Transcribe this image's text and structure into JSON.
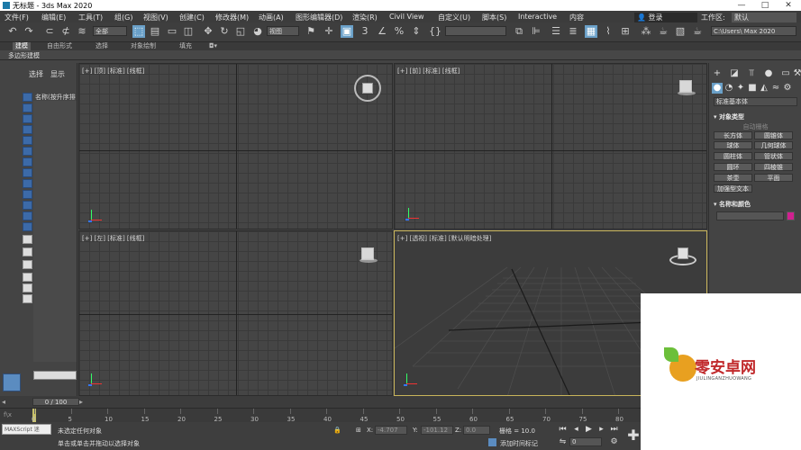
{
  "window": {
    "title": "无标题 - 3ds Max 2020",
    "min": "—",
    "max": "□",
    "close": "✕"
  },
  "menu": [
    "文件(F)",
    "编辑(E)",
    "工具(T)",
    "组(G)",
    "视图(V)",
    "创建(C)",
    "修改器(M)",
    "动画(A)",
    "图形编辑器(D)",
    "渲染(R)",
    "Civil View",
    "自定义(U)",
    "脚本(S)",
    "Interactive",
    "内容"
  ],
  "user": {
    "login": "登录",
    "workspace_label": "工作区:",
    "workspace_value": "默认"
  },
  "toolbar": {
    "selection_filter": "全部",
    "view_dropdown": "视图",
    "path": "C:\\Users\\ Max 2020"
  },
  "ribbon": {
    "tabs": [
      "建模",
      "自由形式",
      "选择",
      "对象绘制",
      "填充"
    ],
    "active_tab": "建模",
    "subbar": "多边形建模"
  },
  "scene_explorer": {
    "tabs": [
      "选择",
      "显示"
    ],
    "column_header": "名称(按升序排"
  },
  "viewports": {
    "top": "[+] [顶] [标准] [线框]",
    "front": "[+] [前] [标准] [线框]",
    "left": "[+] [左] [标准] [线框]",
    "persp": "[+] [透视] [标准] [默认明暗处理]"
  },
  "command_panel": {
    "category": "标准基本体",
    "object_type_header": "对象类型",
    "auto_grid": "自动栅格",
    "buttons": [
      "长方体",
      "圆锥体",
      "球体",
      "几何球体",
      "圆柱体",
      "管状体",
      "圆环",
      "四棱锥",
      "茶壶",
      "平面",
      "加强型文本"
    ],
    "name_color_header": "名称和颜色",
    "color": "#d02090"
  },
  "timeline": {
    "slider": "0 / 100",
    "ticks": [
      "0",
      "5",
      "10",
      "15",
      "20",
      "25",
      "30",
      "35",
      "40",
      "45",
      "50",
      "55",
      "60",
      "65",
      "70",
      "75",
      "80"
    ]
  },
  "status": {
    "script_listener": "MAXScript 迷",
    "line1": "未选定任何对象",
    "line2": "单击或单击并拖动以选择对象",
    "x_label": "X:",
    "x_value": "-4.707",
    "y_label": "Y:",
    "y_value": "-101.12",
    "z_label": "Z:",
    "z_value": "0.0",
    "grid": "栅格 = 10.0",
    "add_time_tag": "添加时间标记",
    "frame": "0"
  },
  "watermark": {
    "name": "零安卓网",
    "sub": "JIULINGANZHUOWANG"
  }
}
